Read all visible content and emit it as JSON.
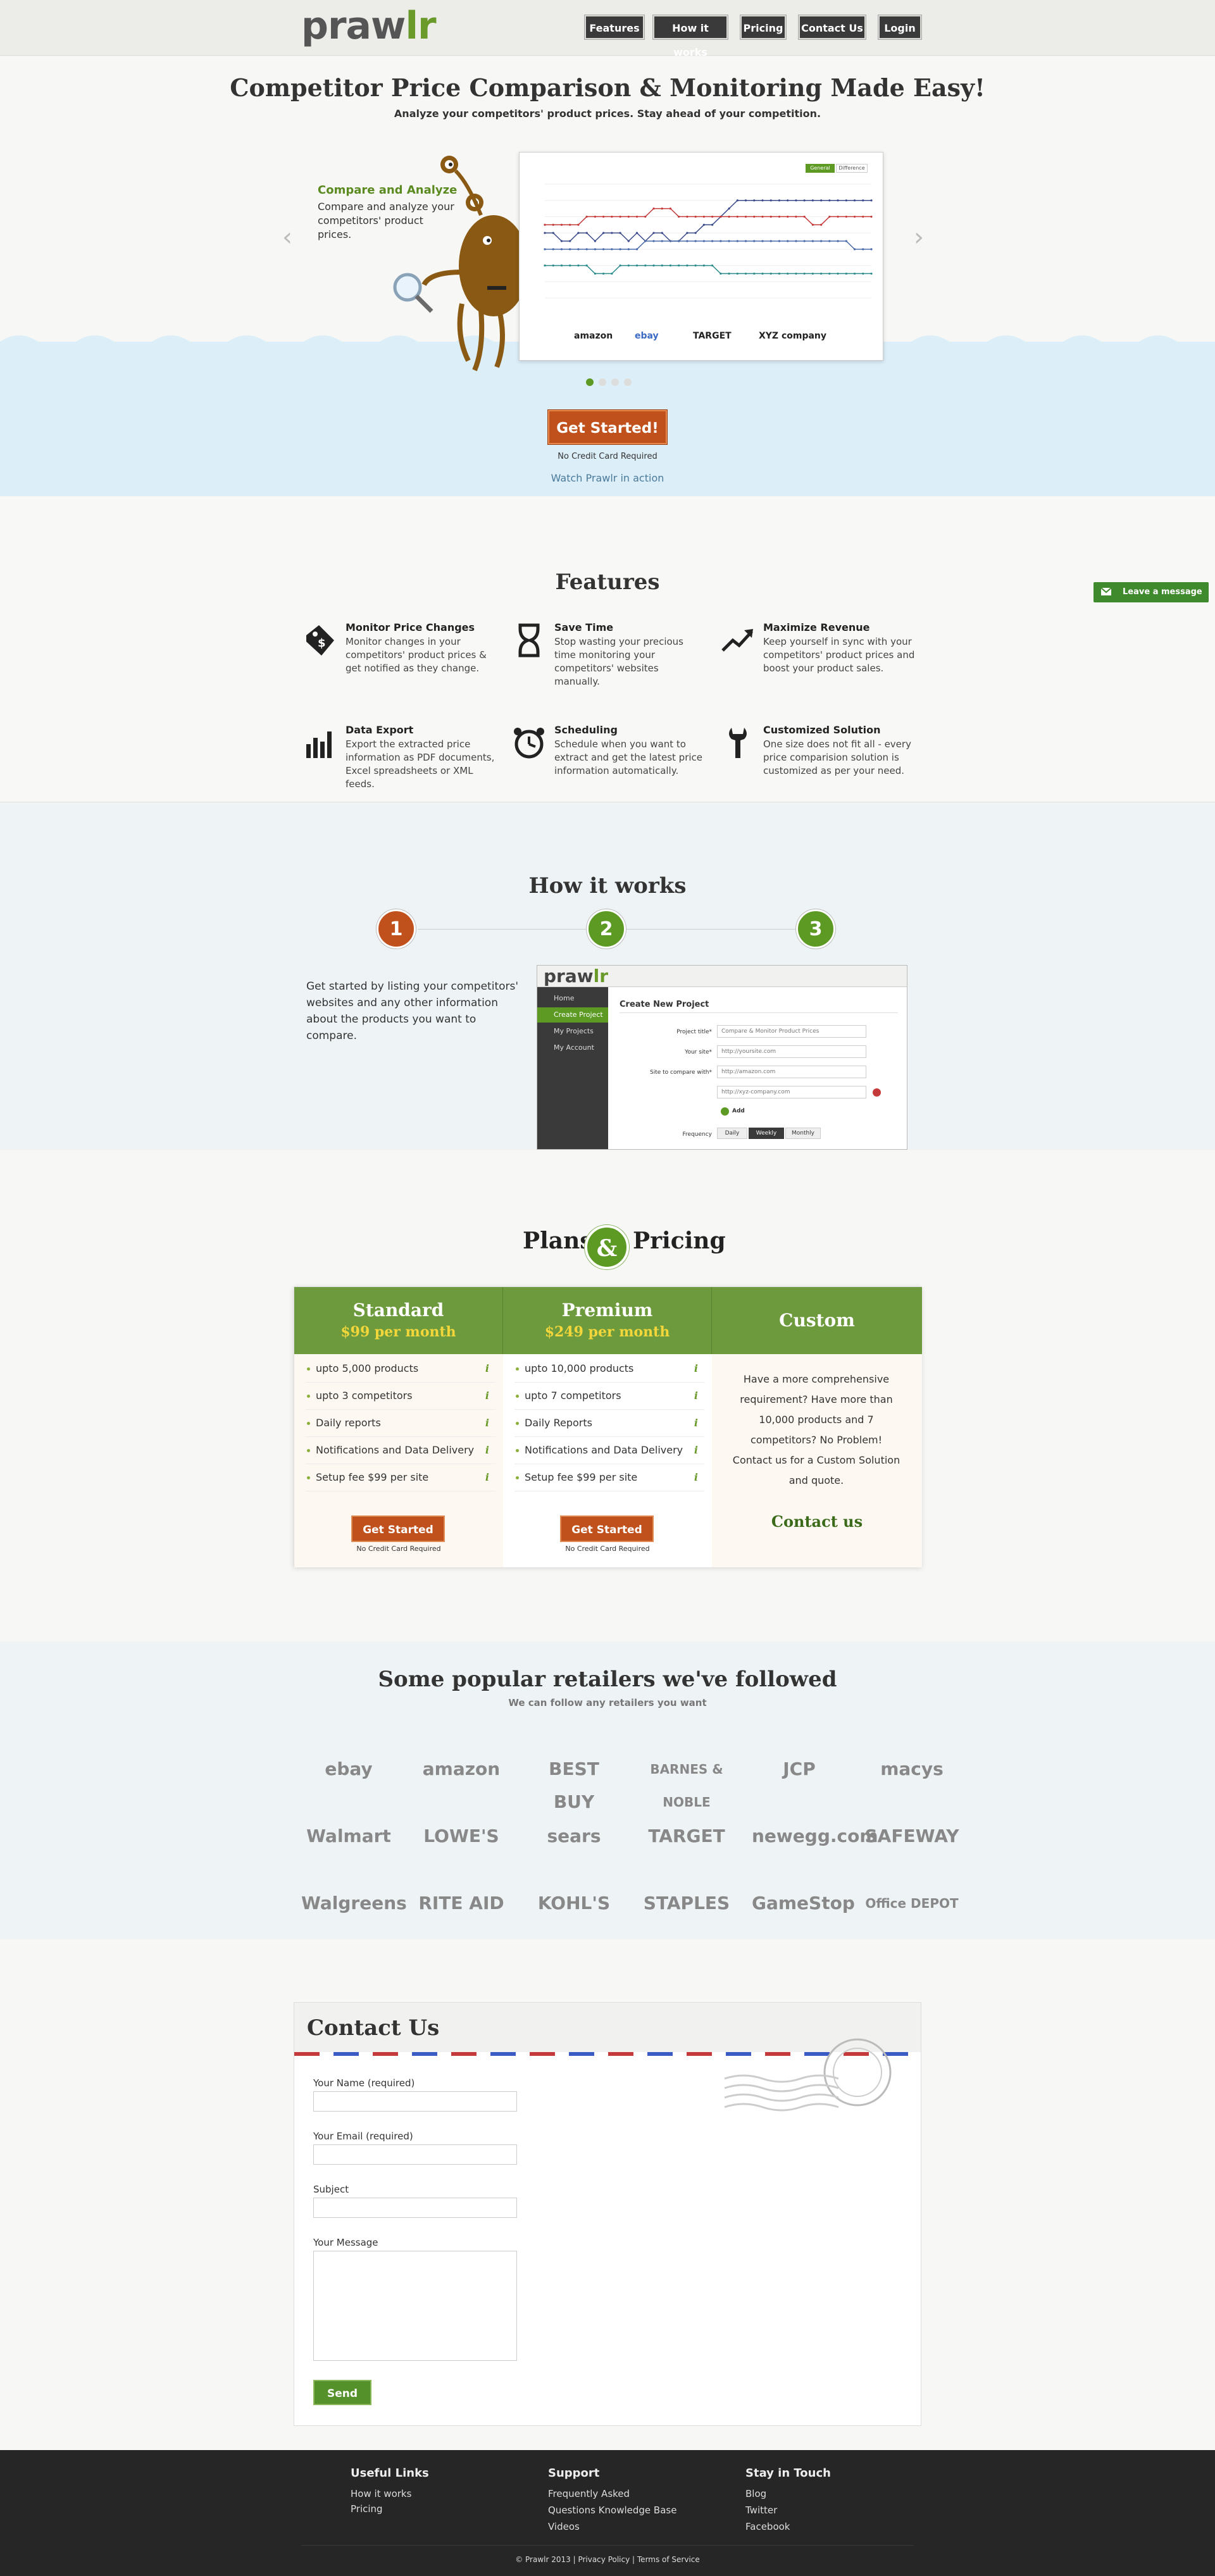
{
  "header": {
    "logo_main": "praw",
    "logo_accent": "lr",
    "nav": [
      "Features",
      "How it works",
      "Pricing",
      "Contact Us",
      "Login"
    ]
  },
  "hero": {
    "title": "Competitor Price Comparison & Monitoring Made Easy!",
    "subtitle": "Analyze your competitors' product prices. Stay ahead of your competition.",
    "slide_heading": "Compare and Analyze",
    "slide_text": "Compare and analyze your competitors' product prices.",
    "chart_tabs": [
      "General",
      "Difference"
    ],
    "chart_legend": [
      "amazon",
      "ebay",
      "TARGET",
      "XYZ company"
    ],
    "cta": "Get Started!",
    "cta_note": "No Credit Card Required",
    "watch_link": "Watch Prawlr in action"
  },
  "chart_data": {
    "type": "line",
    "series": [
      {
        "name": "amazon",
        "color": "#3a4a8a",
        "values": [
          8,
          8,
          7,
          7,
          8,
          8,
          7,
          8,
          8,
          8,
          7,
          8,
          7,
          8,
          8,
          7,
          7,
          8,
          8,
          9,
          9,
          10,
          11,
          12,
          12,
          12,
          12,
          12,
          12,
          12,
          12,
          12,
          12,
          12,
          12,
          12,
          12,
          12,
          12,
          12
        ]
      },
      {
        "name": "ebay",
        "color": "#c43a3a",
        "values": [
          9,
          9,
          9,
          9,
          9,
          10,
          10,
          10,
          10,
          10,
          10,
          10,
          10,
          11,
          11,
          11,
          10,
          10,
          10,
          10,
          10,
          10,
          10,
          10,
          10,
          10,
          10,
          10,
          10,
          10,
          10,
          10,
          9,
          9,
          10,
          10,
          10,
          10,
          10,
          10
        ]
      },
      {
        "name": "TARGET",
        "color": "#4a6aaa",
        "values": [
          6,
          6,
          6,
          6,
          6,
          6,
          6,
          6,
          6,
          6,
          6,
          6,
          7,
          7,
          7,
          7,
          7,
          7,
          7,
          7,
          7,
          7,
          7,
          7,
          7,
          7,
          7,
          7,
          7,
          7,
          7,
          7,
          7,
          7,
          7,
          7,
          7,
          6,
          6,
          6
        ]
      },
      {
        "name": "XYZ company",
        "color": "#2a8a8a",
        "values": [
          4,
          4,
          4,
          4,
          4,
          4,
          3,
          3,
          3,
          4,
          4,
          4,
          4,
          4,
          4,
          4,
          4,
          4,
          4,
          4,
          4,
          3,
          3,
          3,
          3,
          3,
          3,
          3,
          3,
          3,
          3,
          3,
          3,
          3,
          3,
          3,
          3,
          3,
          3,
          3
        ]
      }
    ]
  },
  "features": {
    "title": "Features",
    "items": [
      {
        "icon": "price-tag-icon",
        "title": "Monitor Price Changes",
        "text": "Monitor changes in your competitors' product prices & get notified as they change."
      },
      {
        "icon": "hourglass-icon",
        "title": "Save Time",
        "text": "Stop wasting your precious time monitoring your competitors' websites manually."
      },
      {
        "icon": "trend-up-icon",
        "title": "Maximize Revenue",
        "text": "Keep yourself in sync with your competitors' product prices and boost your product sales."
      },
      {
        "icon": "bar-chart-icon",
        "title": "Data Export",
        "text": "Export the extracted price information as PDF documents, Excel spreadsheets or XML feeds."
      },
      {
        "icon": "alarm-clock-icon",
        "title": "Scheduling",
        "text": "Schedule when you want to extract and get the latest price information automatically."
      },
      {
        "icon": "wrench-icon",
        "title": "Customized Solution",
        "text": "One size does not fit all - every price comparision solution is customized as per your need."
      }
    ],
    "leave_message": "Leave a message"
  },
  "how": {
    "title": "How it works",
    "steps": [
      "1",
      "2",
      "3"
    ],
    "step_colors": [
      "#c0511c",
      "#5c9a24",
      "#5c9a24"
    ],
    "text": "Get started by listing your competitors' websites and any other information about the products you want to compare.",
    "app": {
      "logo_main": "praw",
      "logo_accent": "lr",
      "menu": [
        "Home",
        "Create Project",
        "My Projects",
        "My Account"
      ],
      "heading": "Create New Project",
      "fields": [
        {
          "label": "Project title*",
          "value": "Compare & Monitor Product Prices"
        },
        {
          "label": "Your site*",
          "value": "http://yoursite.com"
        },
        {
          "label": "Site to compare with*",
          "value": "http://amazon.com"
        },
        {
          "label": "",
          "value": "http://xyz-company.com"
        }
      ],
      "add": "Add",
      "frequency_label": "Frequency",
      "frequency_options": [
        "Daily",
        "Weekly",
        "Monthly"
      ]
    }
  },
  "plans": {
    "title_left": "Plans",
    "amp": "&",
    "title_right": "Pricing",
    "columns": [
      {
        "name": "Standard",
        "price": "$99 per month",
        "items": [
          "upto 5,000 products",
          "upto 3 competitors",
          "Daily reports",
          "Notifications and Data Delivery",
          "Setup fee $99 per site"
        ],
        "button": "Get Started",
        "note": "No Credit Card Required"
      },
      {
        "name": "Premium",
        "price": "$249 per month",
        "items": [
          "upto 10,000 products",
          "upto 7 competitors",
          "Daily Reports",
          "Notifications and Data Delivery",
          "Setup fee $99 per site"
        ],
        "button": "Get Started",
        "note": "No Credit Card Required"
      },
      {
        "name": "Custom",
        "text": "Have a more comprehensive requirement? Have more than 10,000 products and 7 competitors? No Problem! Contact us for a Custom Solution and quote.",
        "link": "Contact us"
      }
    ],
    "info_glyph": "i"
  },
  "retailers": {
    "title": "Some popular retailers we've followed",
    "subtitle": "We can follow any retailers you want",
    "logos": [
      "ebay",
      "amazon",
      "BEST BUY",
      "BARNES & NOBLE",
      "JCP",
      "macys",
      "Walmart",
      "LOWE'S",
      "sears",
      "TARGET",
      "newegg.com",
      "SAFEWAY",
      "Walgreens",
      "RITE AID",
      "KOHL'S",
      "STAPLES",
      "GameStop",
      "Office DEPOT"
    ]
  },
  "contact": {
    "title": "Contact Us",
    "fields": [
      "Your Name (required)",
      "Your Email (required)",
      "Subject",
      "Your Message"
    ],
    "send": "Send"
  },
  "footer": {
    "columns": [
      {
        "title": "Useful Links",
        "links": [
          "How it works",
          "Pricing"
        ]
      },
      {
        "title": "Support",
        "links": [
          "Frequently Asked",
          "Questions Knowledge Base",
          "Videos"
        ]
      },
      {
        "title": "Stay in Touch",
        "links": [
          "Blog",
          "Twitter",
          "Facebook"
        ]
      }
    ],
    "copyright": "© Prawlr 2013 | Privacy Policy | Terms of Service"
  }
}
